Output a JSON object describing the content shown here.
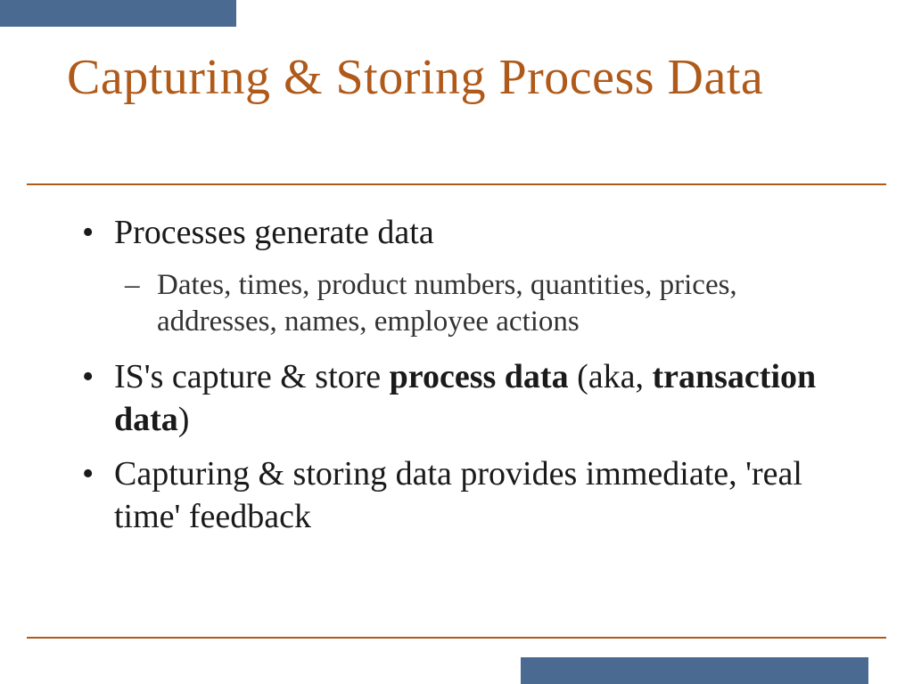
{
  "title": "Capturing & Storing Process Data",
  "bullets": {
    "b1": "Processes generate data",
    "b1a": "Dates, times, product numbers, quantities, prices, addresses, names, employee actions",
    "b2_pre": "IS's capture & store ",
    "b2_bold1": "process data",
    "b2_mid": " (aka, ",
    "b2_bold2": "transaction data",
    "b2_post": ")",
    "b3": "Capturing & storing data provides immediate, 'real time' feedback"
  },
  "colors": {
    "accent_bar": "#4a6a92",
    "title": "#b05a1a",
    "rule": "#b05a1a"
  }
}
